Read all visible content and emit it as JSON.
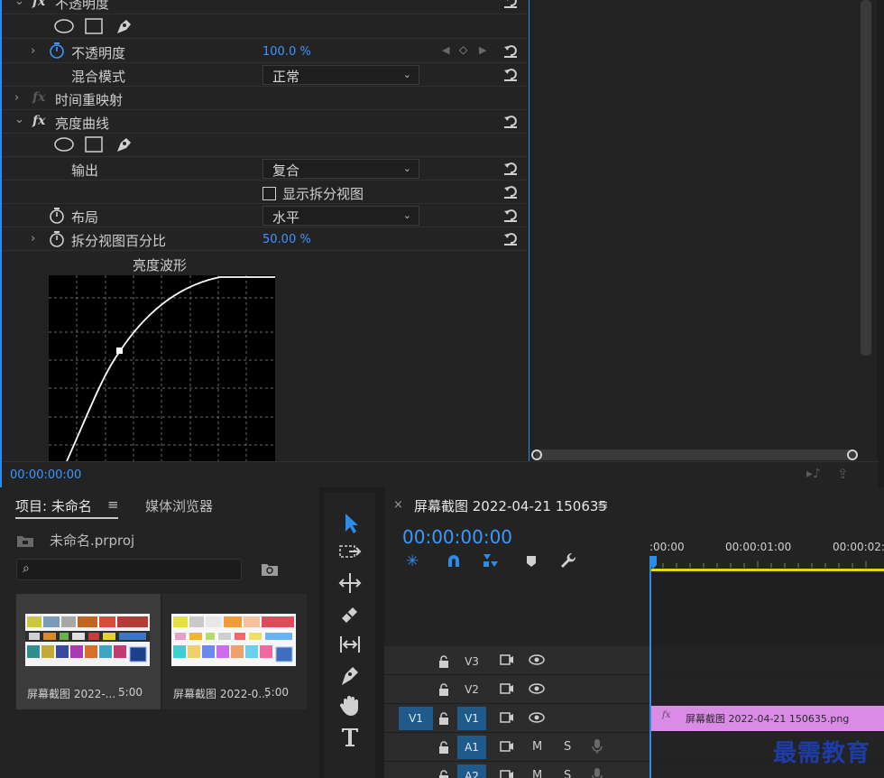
{
  "effect_controls": {
    "opacity_section": {
      "label": "不透明度"
    },
    "opacity": {
      "label": "不透明度",
      "value": "100.0 %"
    },
    "blend_mode": {
      "label": "混合模式",
      "value": "正常"
    },
    "time_remap": {
      "label": "时间重映射"
    },
    "luma_curve": {
      "label": "亮度曲线"
    },
    "output": {
      "label": "输出",
      "value": "复合"
    },
    "split_view": {
      "label": "显示拆分视图"
    },
    "layout": {
      "label": "布局",
      "value": "水平"
    },
    "split_percent": {
      "label": "拆分视图百分比",
      "value": "50.00 %"
    },
    "graph_title": "亮度波形",
    "timecode": "00:00:00:00",
    "fx_symbol": "fx"
  },
  "project": {
    "tab_project": "项目: 未命名",
    "tab_menu": "≡",
    "tab_media": "媒体浏览器",
    "file": "未命名.prproj",
    "items": [
      {
        "name": "屏幕截图 2022-...",
        "duration": "5:00"
      },
      {
        "name": "屏幕截图 2022-0...",
        "duration": "5:00"
      }
    ]
  },
  "timeline": {
    "close": "×",
    "title": "屏幕截图 2022-04-21 150635",
    "menu": "≡",
    "timecode": "00:00:00:00",
    "ruler": [
      ":00:00",
      "00:00:01:00",
      "00:00:02:"
    ],
    "tracks": [
      {
        "name": "V3"
      },
      {
        "name": "V2"
      },
      {
        "name": "V1",
        "source": "V1"
      },
      {
        "name": "A1",
        "mute": "M",
        "solo": "S"
      },
      {
        "name": "A2",
        "mute": "M",
        "solo": "S"
      }
    ],
    "clip_name": "屏幕截图  2022-04-21  150635.png",
    "clip_fx": "fx"
  },
  "watermark": "最需教育",
  "colors": {
    "accent": "#2d8ceb",
    "value_blue": "#3d97ff",
    "clip": "#d98be5",
    "track_active": "#1e5a8c",
    "panel": "#232323"
  }
}
